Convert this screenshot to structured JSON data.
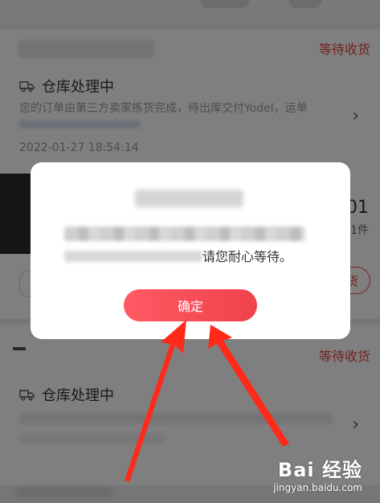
{
  "orders": [
    {
      "status": "等待收货",
      "warehouse_title": "仓库处理中",
      "description": "您的订单由第三方卖家拣货完成，待出库交付Yodel，运单",
      "time": "2022-01-27 18:54:14",
      "price_partial": "0.01",
      "qty_partial": "1件",
      "action_partial": "货"
    },
    {
      "status": "等待收货",
      "warehouse_title": "仓库处理中"
    }
  ],
  "dialog": {
    "message_visible": "请您耐心等待。",
    "confirm_label": "确定"
  },
  "watermark": {
    "logo": "Bai 经验",
    "url": "jingyan.baidu.com"
  },
  "colors": {
    "accent": "#f0424c",
    "status": "#e64545",
    "overlay": "rgba(0,0,0,0.5)",
    "arrow": "#ff2a1a"
  }
}
